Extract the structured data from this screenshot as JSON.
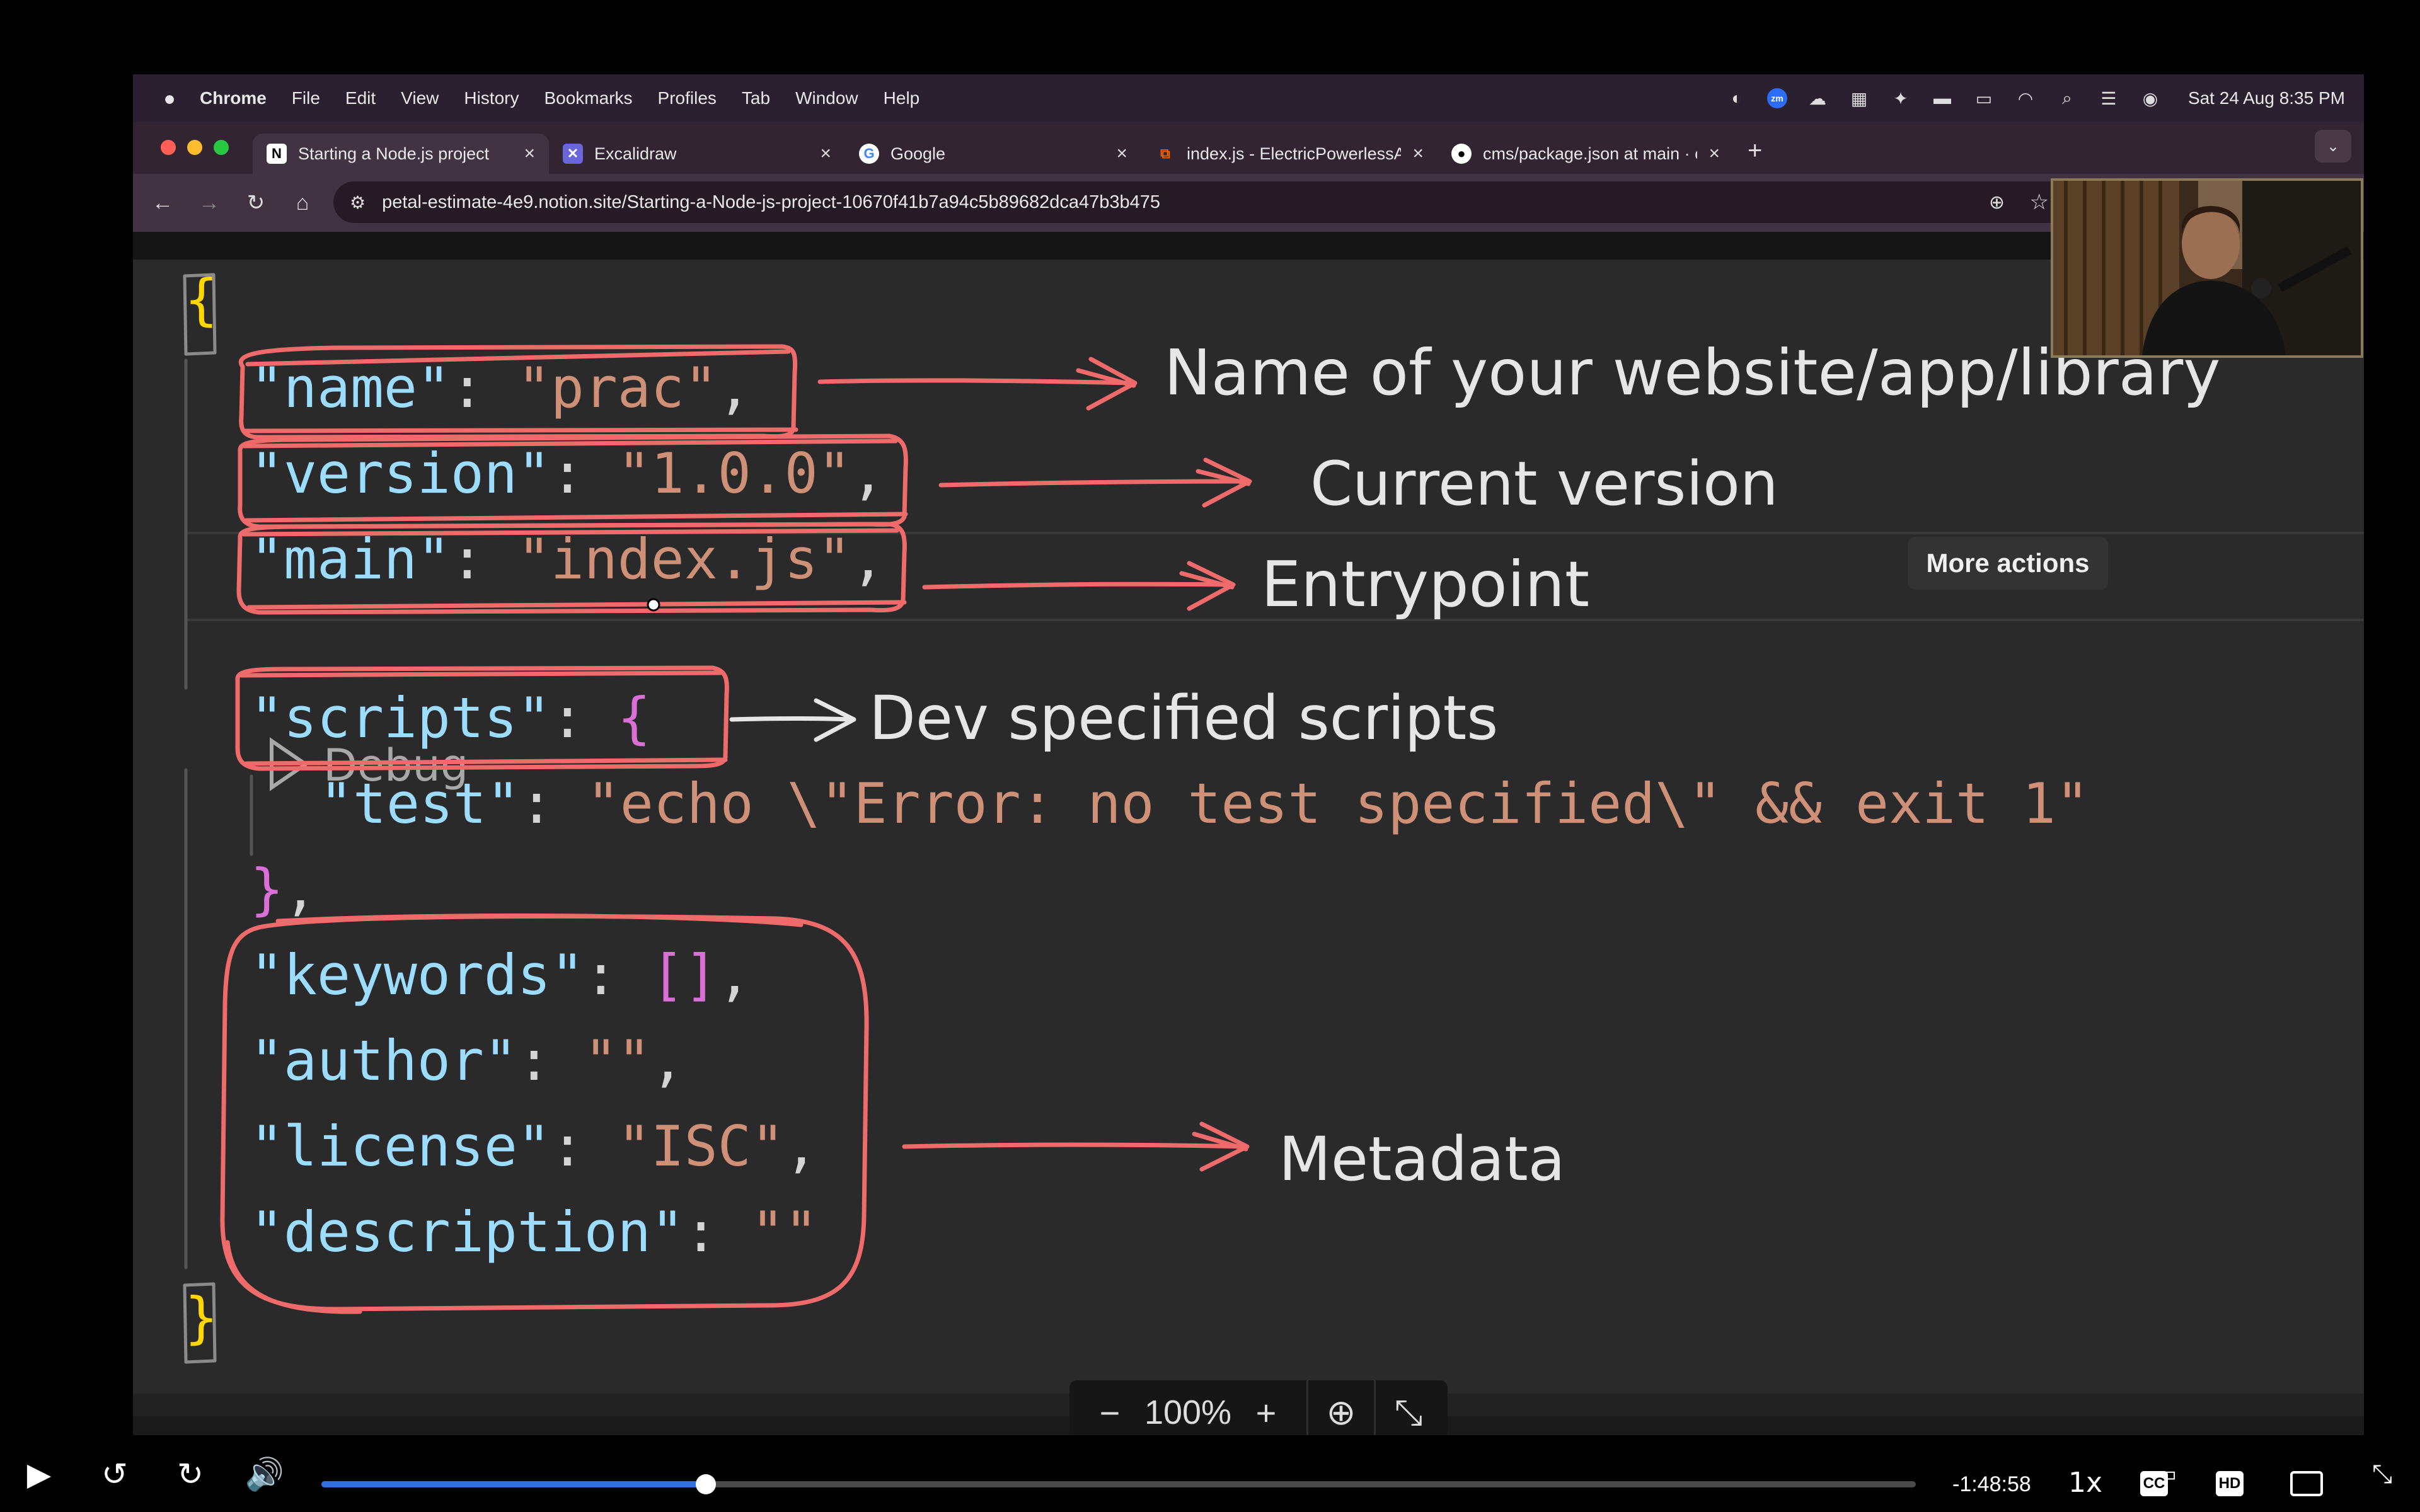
{
  "menubar": {
    "app": "Chrome",
    "items": [
      "File",
      "Edit",
      "View",
      "History",
      "Bookmarks",
      "Profiles",
      "Tab",
      "Window",
      "Help"
    ],
    "clock": "Sat 24 Aug  8:35 PM"
  },
  "tabs": [
    {
      "title": "Starting a Node.js project",
      "icon": "notion-icon",
      "active": true
    },
    {
      "title": "Excalidraw",
      "icon": "excalidraw-icon",
      "active": false
    },
    {
      "title": "Google",
      "icon": "google-icon",
      "active": false
    },
    {
      "title": "index.js - ElectricPowerlessA",
      "icon": "replit-icon",
      "active": false
    },
    {
      "title": "cms/package.json at main · c",
      "icon": "github-icon",
      "active": false
    }
  ],
  "address": {
    "url": "petal-estimate-4e9.notion.site/Starting-a-Node-js-project-10670f41b7a94c5b89682dca47b3b475"
  },
  "code": {
    "open_brace": "{",
    "name_key": "\"name\"",
    "name_val": "\"prac\"",
    "version_key": "\"version\"",
    "version_val": "\"1.0.0\"",
    "main_key": "\"main\"",
    "main_val": "\"index.js\"",
    "debug": "Debug",
    "scripts_key": "\"scripts\"",
    "scripts_brace": "{",
    "test_key": "\"test\"",
    "test_val": "\"echo \\\"Error: no test specified\\\" && exit 1\"",
    "scripts_close": "}",
    "keywords_key": "\"keywords\"",
    "keywords_val": "[]",
    "author_key": "\"author\"",
    "author_val": "\"\"",
    "license_key": "\"license\"",
    "license_val": "\"ISC\"",
    "description_key": "\"description\"",
    "description_val": "\"\"",
    "close_brace": "}",
    "colon": ": ",
    "comma": ","
  },
  "annotations": {
    "name": "Name of your website/app/library",
    "version": "Current version",
    "main": "Entrypoint",
    "scripts": "Dev specified scripts",
    "metadata": "Metadata"
  },
  "tooltip": "More actions",
  "zoom": {
    "level": "100%",
    "minus": "−",
    "plus": "+"
  },
  "player": {
    "remaining": "-1:48:58",
    "speed": "1x",
    "cc": "CC",
    "hd": "HD",
    "progress_fraction": 0.241
  },
  "colors": {
    "annotation_stroke": "#ef6b6b",
    "json_key": "#9cdcfe",
    "json_string": "#ce9178",
    "progress": "#2f6fe0"
  }
}
